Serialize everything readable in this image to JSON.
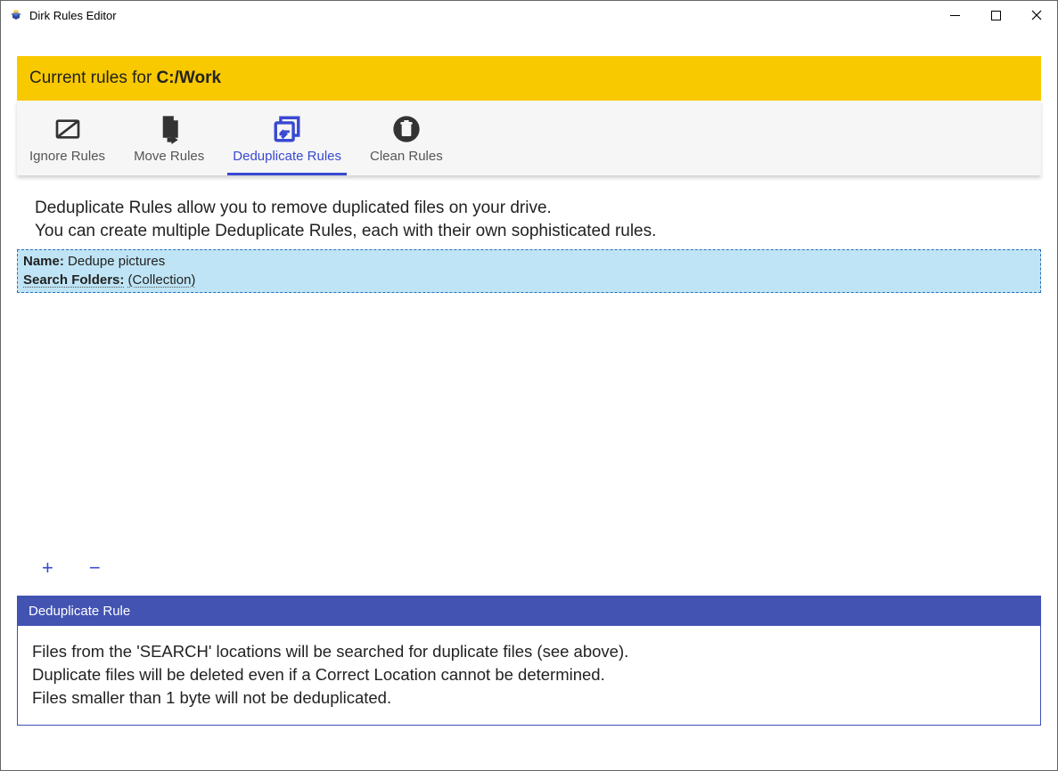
{
  "window": {
    "title": "Dirk Rules Editor"
  },
  "banner": {
    "prefix": "Current rules for ",
    "path": "C:/Work"
  },
  "tabs": [
    {
      "label": "Ignore Rules"
    },
    {
      "label": "Move Rules"
    },
    {
      "label": "Deduplicate Rules"
    },
    {
      "label": "Clean Rules"
    }
  ],
  "description": {
    "line1": "Deduplicate Rules allow you to remove duplicated files on your drive.",
    "line2": "You can create multiple Deduplicate Rules, each with their own sophisticated rules."
  },
  "rule": {
    "name_label": "Name:",
    "name_value": "Dedupe pictures",
    "search_label": "Search Folders:",
    "search_value": "(Collection)"
  },
  "controls": {
    "add": "+",
    "remove": "−"
  },
  "panel": {
    "title": "Deduplicate Rule",
    "line1": "Files from the 'SEARCH' locations will be searched for duplicate files (see above).",
    "line2": "Duplicate files will be deleted even if a Correct Location cannot be determined.",
    "line3": "Files smaller than 1 byte will not be deduplicated."
  }
}
